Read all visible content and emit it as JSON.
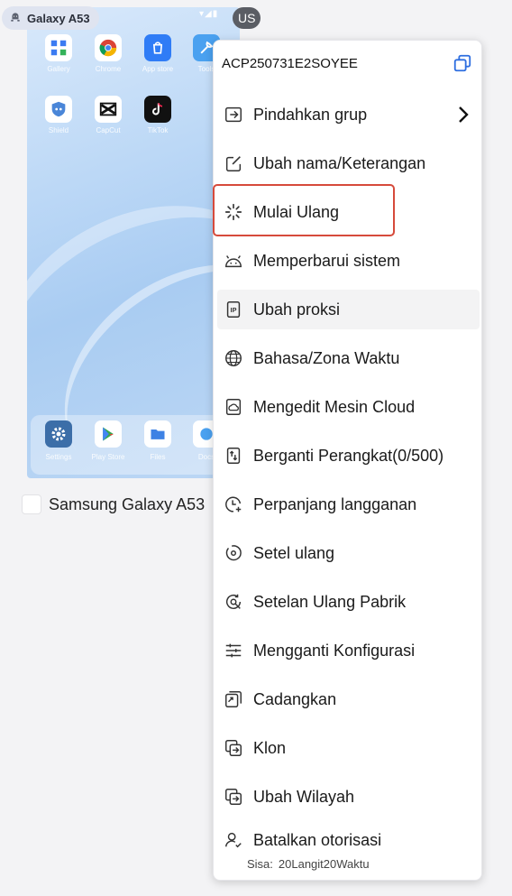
{
  "device_card": {
    "device_tag": "Galaxy A53",
    "region_tag": "US",
    "status_icons": "▾◢▮",
    "device_name": "Samsung Galaxy A53",
    "apps": [
      {
        "label": "Gallery",
        "color": "#3b7bf2"
      },
      {
        "label": "Chrome",
        "color": "#ffffff"
      },
      {
        "label": "App store",
        "color": "#2f7cf6"
      },
      {
        "label": "Tools",
        "color": "#4aa1f0"
      },
      {
        "label": "Shield",
        "color": "#ffffff"
      },
      {
        "label": "CapCut",
        "color": "#ffffff"
      },
      {
        "label": "TikTok",
        "color": "#111111"
      }
    ],
    "dock_apps": [
      {
        "label": "Settings",
        "color": "#3c6ea8"
      },
      {
        "label": "Play Store",
        "color": "#ffffff"
      },
      {
        "label": "Files",
        "color": "#ffffff"
      },
      {
        "label": "Docs",
        "color": "#ffffff"
      }
    ]
  },
  "menu": {
    "device_id": "ACP250731E2SOYEE",
    "items": [
      {
        "label": "Pindahkan grup",
        "icon": "move-group-icon"
      },
      {
        "label": "Ubah nama/Keterangan",
        "icon": "edit-icon"
      },
      {
        "label": "Mulai Ulang",
        "icon": "restart-icon"
      },
      {
        "label": "Memperbarui sistem",
        "icon": "android-icon"
      },
      {
        "label": "Ubah proksi",
        "icon": "proxy-icon"
      },
      {
        "label": "Bahasa/Zona Waktu",
        "icon": "globe-icon"
      },
      {
        "label": "Mengedit Mesin Cloud",
        "icon": "cloud-edit-icon"
      },
      {
        "label": "Berganti Perangkat(0/500)",
        "icon": "switch-device-icon"
      },
      {
        "label": "Perpanjang langganan",
        "icon": "clock-plus-icon"
      },
      {
        "label": "Setel ulang",
        "icon": "reset-icon"
      },
      {
        "label": "Setelan Ulang Pabrik",
        "icon": "factory-reset-icon"
      },
      {
        "label": "Mengganti Konfigurasi",
        "icon": "sliders-icon"
      },
      {
        "label": "Cadangkan",
        "icon": "backup-icon"
      },
      {
        "label": "Klon",
        "icon": "clone-icon"
      },
      {
        "label": "Ubah Wilayah",
        "icon": "region-icon"
      },
      {
        "label": "Batalkan otorisasi",
        "icon": "user-revoke-icon"
      }
    ],
    "footer_label": "Sisa:",
    "footer_value": "20Langit20Waktu"
  },
  "colors": {
    "highlight_border": "#d64a3b",
    "hover_bg": "#f3f3f4"
  }
}
